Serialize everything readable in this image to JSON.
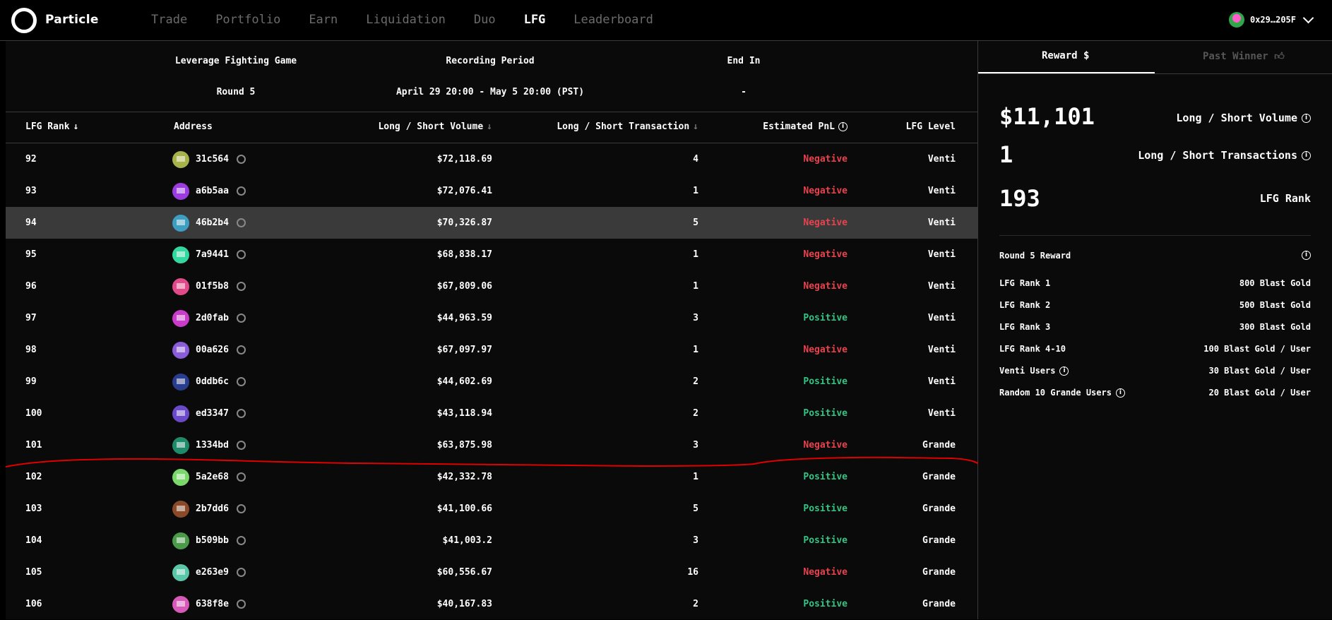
{
  "nav": {
    "brand": "Particle",
    "items": [
      "Trade",
      "Portfolio",
      "Earn",
      "Liquidation",
      "Duo",
      "LFG",
      "Leaderboard"
    ],
    "active": "LFG",
    "wallet": "0x29…205F"
  },
  "info": {
    "game_label": "Leverage Fighting Game",
    "game_value": "Round 5",
    "period_label": "Recording Period",
    "period_value": "April 29 20:00 - May 5 20:00 (PST)",
    "end_label": "End In",
    "end_value": "-"
  },
  "table": {
    "headers": {
      "rank": "LFG Rank",
      "address": "Address",
      "volume": "Long / Short Volume",
      "transactions": "Long / Short Transaction",
      "pnl": "Estimated PnL",
      "level": "LFG Level"
    },
    "rows": [
      {
        "rank": "92",
        "address": "31c564",
        "volume": "$72,118.69",
        "tx": "4",
        "pnl": "Negative",
        "level": "Venti",
        "avatar": "#a8b24a"
      },
      {
        "rank": "93",
        "address": "a6b5aa",
        "volume": "$72,076.41",
        "tx": "1",
        "pnl": "Negative",
        "level": "Venti",
        "avatar": "#9b3ce0"
      },
      {
        "rank": "94",
        "address": "46b2b4",
        "volume": "$70,326.87",
        "tx": "5",
        "pnl": "Negative",
        "level": "Venti",
        "avatar": "#3d9ec0"
      },
      {
        "rank": "95",
        "address": "7a9441",
        "volume": "$68,838.17",
        "tx": "1",
        "pnl": "Negative",
        "level": "Venti",
        "avatar": "#34d7a0"
      },
      {
        "rank": "96",
        "address": "01f5b8",
        "volume": "$67,809.06",
        "tx": "1",
        "pnl": "Negative",
        "level": "Venti",
        "avatar": "#e04a8a"
      },
      {
        "rank": "97",
        "address": "2d0fab",
        "volume": "$44,963.59",
        "tx": "3",
        "pnl": "Positive",
        "level": "Venti",
        "avatar": "#c93cc9"
      },
      {
        "rank": "98",
        "address": "00a626",
        "volume": "$67,097.97",
        "tx": "1",
        "pnl": "Negative",
        "level": "Venti",
        "avatar": "#8a5cd8"
      },
      {
        "rank": "99",
        "address": "0ddb6c",
        "volume": "$44,602.69",
        "tx": "2",
        "pnl": "Positive",
        "level": "Venti",
        "avatar": "#2a3c8c"
      },
      {
        "rank": "100",
        "address": "ed3347",
        "volume": "$43,118.94",
        "tx": "2",
        "pnl": "Positive",
        "level": "Venti",
        "avatar": "#6a4ac8"
      },
      {
        "rank": "101",
        "address": "1334bd",
        "volume": "$63,875.98",
        "tx": "3",
        "pnl": "Negative",
        "level": "Grande",
        "avatar": "#1f8a6a"
      },
      {
        "rank": "102",
        "address": "5a2e68",
        "volume": "$42,332.78",
        "tx": "1",
        "pnl": "Positive",
        "level": "Grande",
        "avatar": "#7ad86a"
      },
      {
        "rank": "103",
        "address": "2b7dd6",
        "volume": "$41,100.66",
        "tx": "5",
        "pnl": "Positive",
        "level": "Grande",
        "avatar": "#8a4a2a"
      },
      {
        "rank": "104",
        "address": "b509bb",
        "volume": "$41,003.2",
        "tx": "3",
        "pnl": "Positive",
        "level": "Grande",
        "avatar": "#4a9a4a"
      },
      {
        "rank": "105",
        "address": "e263e9",
        "volume": "$60,556.67",
        "tx": "16",
        "pnl": "Negative",
        "level": "Grande",
        "avatar": "#5ac8a8"
      },
      {
        "rank": "106",
        "address": "638f8e",
        "volume": "$40,167.83",
        "tx": "2",
        "pnl": "Positive",
        "level": "Grande",
        "avatar": "#d85ab8"
      }
    ],
    "highlighted_rank": "94"
  },
  "side": {
    "tab_reward": "Reward $",
    "tab_past": "Past Winner",
    "stats": [
      {
        "value": "$11,101",
        "label": "Long / Short Volume",
        "info": true
      },
      {
        "value": "1",
        "label": "Long / Short Transactions",
        "info": true
      },
      {
        "value": "193",
        "label": "LFG Rank",
        "info": false
      }
    ],
    "reward_title": "Round 5 Reward",
    "rewards": [
      {
        "k": "LFG Rank 1",
        "v": "800 Blast Gold",
        "info": false
      },
      {
        "k": "LFG Rank 2",
        "v": "500 Blast Gold",
        "info": false
      },
      {
        "k": "LFG Rank 3",
        "v": "300 Blast Gold",
        "info": false
      },
      {
        "k": "LFG Rank 4-10",
        "v": "100 Blast Gold / User",
        "info": false
      },
      {
        "k": "Venti Users",
        "v": "30 Blast Gold / User",
        "info": true
      },
      {
        "k": "Random 10 Grande Users",
        "v": "20 Blast Gold / User",
        "info": true
      }
    ]
  },
  "colors": {
    "negative": "#e8424e",
    "positive": "#35c483",
    "annotation": "#e00000"
  }
}
